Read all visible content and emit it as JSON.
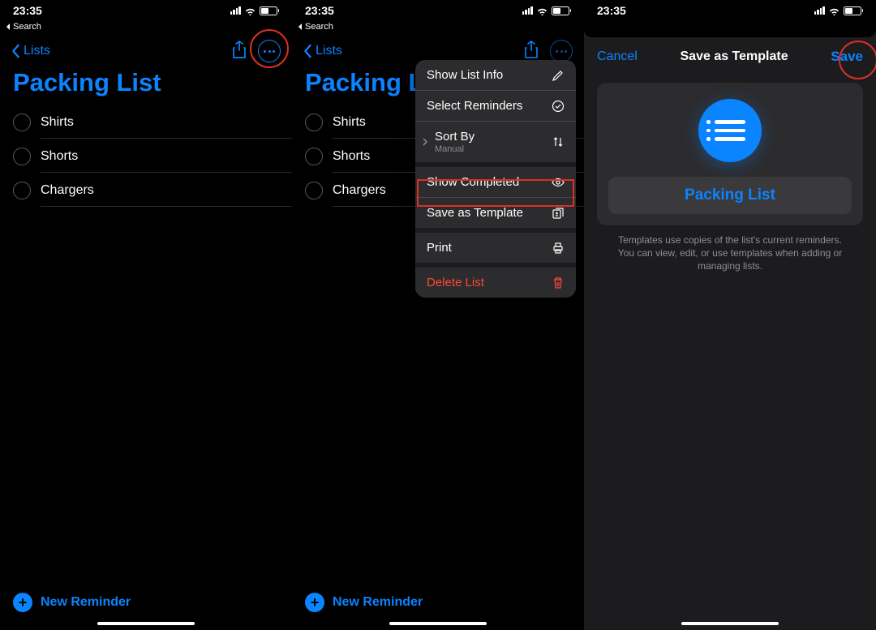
{
  "status": {
    "time": "23:35",
    "back_app": "Search"
  },
  "nav": {
    "back_label": "Lists"
  },
  "list": {
    "title": "Packing List",
    "items": [
      "Shirts",
      "Shorts",
      "Chargers"
    ]
  },
  "footer": {
    "new_reminder": "New Reminder"
  },
  "menu": {
    "show_info": "Show List Info",
    "select": "Select Reminders",
    "sort_by": "Sort By",
    "sort_value": "Manual",
    "show_completed": "Show Completed",
    "save_template": "Save as Template",
    "print": "Print",
    "delete": "Delete List"
  },
  "modal": {
    "cancel": "Cancel",
    "title": "Save as Template",
    "save": "Save",
    "name": "Packing List",
    "hint": "Templates use copies of the list's current reminders. You can view, edit, or use templates when adding or managing lists."
  }
}
